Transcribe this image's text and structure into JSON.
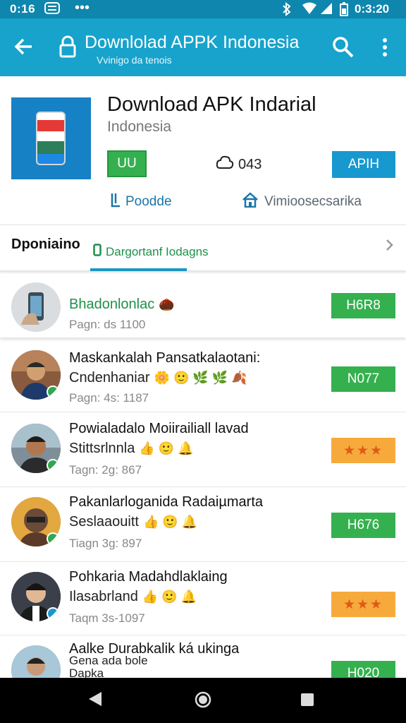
{
  "status_bar": {
    "time": "0:16",
    "right_time": "0:3:20",
    "icons": [
      "message-icon",
      "dots-icon",
      "bluetooth-icon",
      "wifi-icon",
      "signal-icon",
      "battery-icon"
    ]
  },
  "app_bar": {
    "title": "Downlolad APPK Indonesia",
    "subtitle": "Vvinigo da tenois",
    "icons": [
      "back-arrow-icon",
      "lock-icon",
      "search-icon",
      "more-vert-icon"
    ]
  },
  "app": {
    "name": "Download APK Indarial",
    "developer": "Indonesia",
    "install_label": "UU",
    "rating_value": "043",
    "apk_label": "APIH",
    "link_left": "Poodde",
    "link_right": "Vimioosecsarika"
  },
  "tabs": {
    "main": "Dponiaino",
    "active": "Dargortanf Iodagns"
  },
  "list": [
    {
      "name": "Bhadonlonlac",
      "line2": "",
      "meta": "Pagn: ds 1100",
      "action": "H6R8",
      "action_style": "green"
    },
    {
      "name": "Maskankalah Pansatkalaotani:",
      "line2": "Cndenhaniar",
      "meta": "Pagn: 4s: 1187",
      "action": "N077",
      "action_style": "green"
    },
    {
      "name": "Powialadalo Moiirailiall lavad",
      "line2": "Stittsrlnnla",
      "meta": "Tagn: 2g: 867",
      "action": "★★★",
      "action_style": "orange"
    },
    {
      "name": "Pakanlarloganida Radaiµmarta",
      "line2": "Seslaaouitt",
      "meta": "Tiagn 3g: 897",
      "action": "H676",
      "action_style": "green"
    },
    {
      "name": "Pohkaria Madahdlaklaing",
      "line2": "Ilasabrland",
      "meta": "Taqm 3s-1097",
      "action": "★★★",
      "action_style": "orange"
    },
    {
      "name": "Aalke Durabkalik ká ukinga",
      "line2": "Gena ada bole",
      "meta": "Dapka",
      "action": "H020",
      "action_style": "green"
    }
  ],
  "colors": {
    "app_bar": "#17a3cc",
    "status_bar": "#0f86ad",
    "green": "#35b04f",
    "blue": "#1799cf",
    "orange": "#f6aa3c"
  }
}
